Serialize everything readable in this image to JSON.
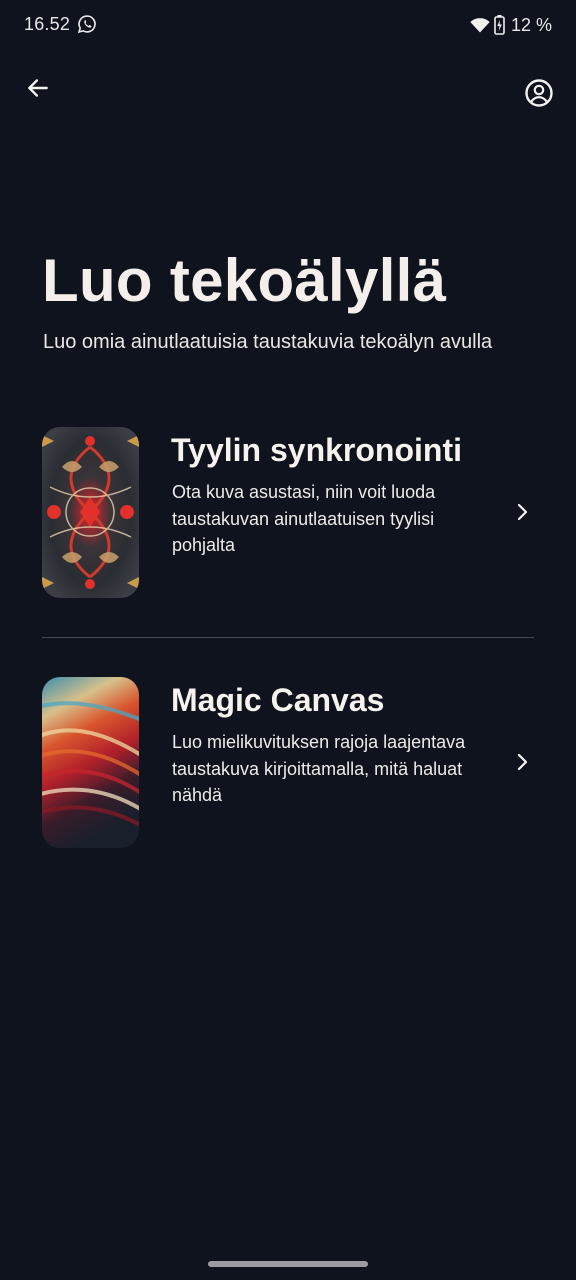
{
  "status_bar": {
    "time": "16.52",
    "battery": "12 %",
    "icons": [
      "whatsapp-icon",
      "wifi-icon",
      "battery-charging-icon"
    ]
  },
  "top_bar": {
    "icons": [
      "arrow-back-icon",
      "account-circle-icon"
    ]
  },
  "header": {
    "title": "Luo tekoälyllä",
    "subtitle": "Luo omia ainutlaatuisia taustakuvia tekoälyn avulla"
  },
  "options": [
    {
      "title": "Tyylin synkronointi",
      "description": "Ota kuva asustasi, niin voit luoda taustakuvan ainutlaatuisen tyylisi pohjalta",
      "icon": "chevron-right-icon"
    },
    {
      "title": "Magic Canvas",
      "description": "Luo mielikuvituksen rajoja laajentava taustakuva kirjoittamalla, mitä haluat nähdä",
      "icon": "chevron-right-icon"
    }
  ],
  "colors": {
    "background": "#0f131d",
    "text": "#f3f1ee",
    "divider": "#444a55"
  }
}
